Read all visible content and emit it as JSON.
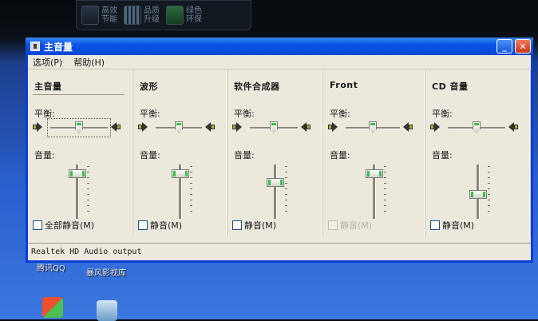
{
  "top_bar": {
    "items": [
      {
        "label": "高效\n节能"
      },
      {
        "label": "品质\n升级"
      },
      {
        "label": "绿色\n环保"
      }
    ]
  },
  "window": {
    "title": "主音量",
    "controls": {
      "minimize": "_",
      "close": "✕"
    },
    "menu": [
      "选项(P)",
      "帮助(H)"
    ],
    "status": "Realtek HD Audio output"
  },
  "channels": [
    {
      "title": "主音量",
      "balance_label": "平衡:",
      "volume_label": "音量:",
      "mute_label": "全部静音(M)",
      "balance": 0.5,
      "volume": 0.9,
      "muted": false,
      "mute_enabled": true
    },
    {
      "title": "波形",
      "balance_label": "平衡:",
      "volume_label": "音量:",
      "mute_label": "静音(M)",
      "balance": 0.5,
      "volume": 0.9,
      "muted": false,
      "mute_enabled": true
    },
    {
      "title": "软件合成器",
      "balance_label": "平衡:",
      "volume_label": "音量:",
      "mute_label": "静音(M)",
      "balance": 0.5,
      "volume": 0.7,
      "muted": false,
      "mute_enabled": true
    },
    {
      "title": "Front",
      "balance_label": "平衡:",
      "volume_label": "音量:",
      "mute_label": "静音(M)",
      "balance": 0.5,
      "volume": 0.9,
      "muted": false,
      "mute_enabled": false
    },
    {
      "title": "CD 音量",
      "balance_label": "平衡:",
      "volume_label": "音量:",
      "mute_label": "静音(M)",
      "balance": 0.5,
      "volume": 0.45,
      "muted": false,
      "mute_enabled": true
    }
  ],
  "desktop": {
    "icons": [
      {
        "label": "腾讯QQ",
        "icon": "qq-icon"
      },
      {
        "label": "暴风影视库",
        "icon": "video-library-icon"
      }
    ]
  },
  "colors": {
    "titlebar": "#0b52e6",
    "window_bg": "#ece8dc",
    "thumb_accent": "#3bbf4c"
  }
}
